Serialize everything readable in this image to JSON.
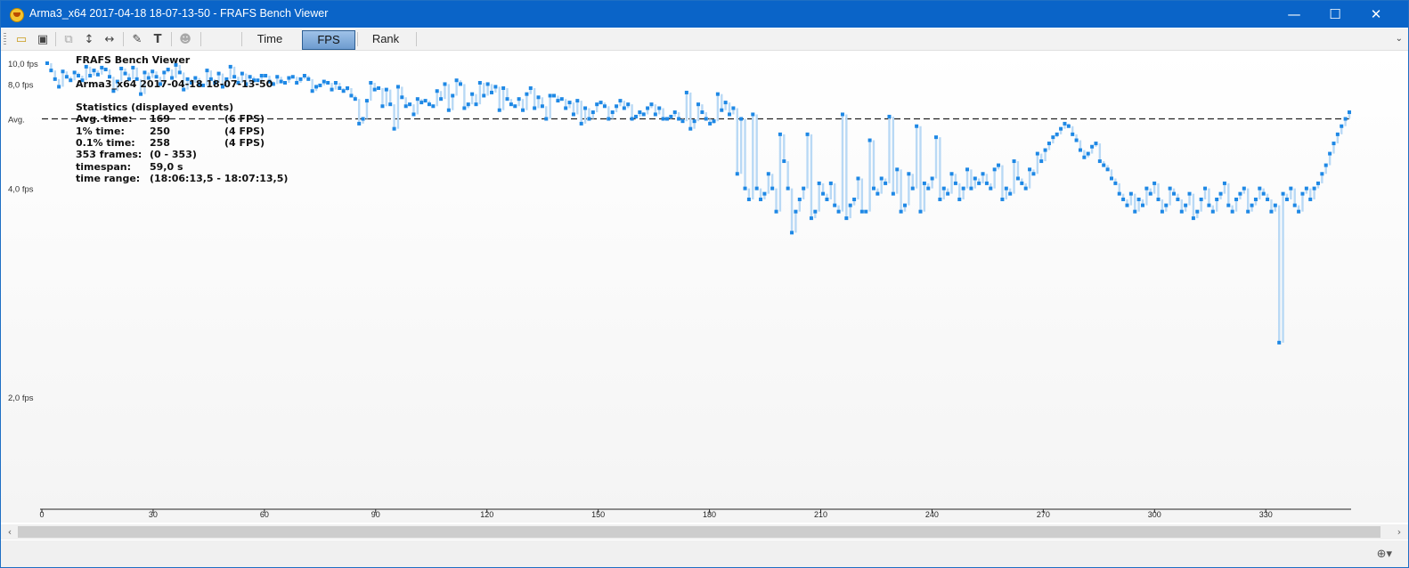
{
  "window": {
    "title": "Arma3_x64 2017-04-18 18-07-13-50 - FRAFS Bench Viewer",
    "controls": {
      "minimize": "—",
      "maximize": "☐",
      "close": "✕"
    }
  },
  "toolbar": {
    "icons": [
      "open-folder-icon",
      "save-icon",
      "copy-icon",
      "fit-height-icon",
      "fit-width-icon",
      "settings-wrench-icon",
      "text-icon",
      "user-icon"
    ],
    "tabs": [
      {
        "label": "Time",
        "active": false
      },
      {
        "label": "FPS",
        "active": true
      },
      {
        "label": "Rank",
        "active": false
      }
    ],
    "overflow": "⌄"
  },
  "stats": {
    "app_name": "FRAFS Bench Viewer",
    "session": "Arma3_x64 2017-04-18 18-07-13-50",
    "heading": "Statistics (displayed events)",
    "rows": [
      {
        "label": "Avg. time:",
        "value": "169",
        "extra": "(6 FPS)"
      },
      {
        "label": "1% time:",
        "value": "250",
        "extra": "(4 FPS)"
      },
      {
        "label": "0.1% time:",
        "value": "258",
        "extra": "(4 FPS)"
      },
      {
        "label": "353 frames:",
        "value": "(0 - 353)",
        "extra": ""
      },
      {
        "label": "timespan:",
        "value": "59,0 s",
        "extra": ""
      },
      {
        "label": "time range:",
        "value": "(18:06:13,5 - 18:07:13,5)",
        "extra": ""
      }
    ]
  },
  "chart_data": {
    "type": "scatter",
    "xlabel": "",
    "ylabel": "",
    "x_ticks": [
      0,
      30,
      60,
      90,
      120,
      150,
      180,
      210,
      240,
      270,
      300,
      330
    ],
    "xlim": [
      0,
      353
    ],
    "y_ticks": [
      {
        "value": 10.0,
        "label": "10,0 fps"
      },
      {
        "value": 8.0,
        "label": "8,0 fps"
      },
      {
        "value": 6.0,
        "label": "Avg."
      },
      {
        "value": 4.0,
        "label": "4,0 fps"
      },
      {
        "value": 2.0,
        "label": "2,0 fps"
      }
    ],
    "ylim": [
      0,
      10.0
    ],
    "average": 6.0,
    "average_label": "Avg.",
    "grid": false,
    "point_color": "#1e88e5",
    "segment_color": "#b9d9f5",
    "series": [
      {
        "values": [
          10.0,
          9.2,
          8.4,
          7.8,
          9.1,
          8.6,
          8.3,
          9.0,
          8.7,
          8.3,
          9.6,
          8.7,
          9.2,
          8.8,
          9.5,
          9.3,
          8.6,
          7.5,
          8.2,
          9.4,
          8.9,
          8.4,
          9.5,
          8.4,
          7.3,
          9.0,
          8.5,
          9.1,
          8.6,
          8.0,
          9.0,
          9.3,
          8.5,
          9.8,
          9.0,
          7.6,
          8.4,
          8.1,
          8.5,
          8.0,
          7.9,
          9.2,
          8.4,
          8.1,
          8.9,
          7.8,
          8.4,
          9.6,
          8.6,
          8.1,
          8.9,
          8.0,
          8.6,
          8.3,
          8.3,
          8.7,
          8.7,
          8.2,
          8.0,
          8.6,
          8.2,
          8.1,
          8.5,
          8.6,
          8.1,
          8.4,
          8.7,
          8.4,
          7.5,
          7.8,
          7.9,
          8.2,
          8.1,
          7.6,
          8.1,
          7.7,
          7.5,
          7.7,
          7.2,
          7.0,
          5.8,
          6.0,
          6.9,
          8.1,
          7.6,
          7.7,
          6.6,
          7.6,
          6.7,
          5.6,
          7.8,
          7.1,
          6.6,
          6.7,
          6.2,
          7.0,
          6.8,
          6.9,
          6.7,
          6.6,
          7.5,
          7.0,
          8.0,
          6.4,
          7.2,
          8.3,
          8.0,
          6.5,
          6.7,
          7.3,
          6.7,
          8.1,
          7.2,
          8.0,
          7.4,
          7.8,
          6.4,
          7.7,
          7.0,
          6.7,
          6.6,
          7.0,
          6.4,
          7.3,
          7.7,
          6.5,
          7.1,
          6.6,
          6.0,
          7.2,
          7.2,
          6.9,
          7.0,
          6.5,
          6.8,
          6.2,
          6.9,
          5.8,
          6.5,
          6.0,
          6.3,
          6.7,
          6.8,
          6.6,
          6.0,
          6.3,
          6.6,
          6.9,
          6.5,
          6.7,
          6.0,
          6.1,
          6.3,
          6.2,
          6.5,
          6.7,
          6.2,
          6.5,
          6.0,
          6.0,
          6.1,
          6.3,
          6.0,
          5.9,
          7.4,
          5.6,
          5.9,
          6.7,
          6.3,
          6.0,
          5.8,
          5.9,
          7.3,
          6.4,
          6.8,
          6.2,
          6.5,
          4.3,
          6.0,
          4.0,
          3.8,
          6.2,
          4.0,
          3.8,
          3.9,
          4.3,
          4.0,
          3.6,
          5.4,
          4.6,
          4.0,
          3.3,
          3.6,
          3.8,
          4.0,
          5.4,
          3.5,
          3.6,
          4.1,
          3.9,
          3.8,
          4.1,
          3.7,
          3.6,
          6.2,
          3.5,
          3.7,
          3.8,
          4.2,
          3.6,
          3.6,
          5.2,
          4.0,
          3.9,
          4.2,
          4.1,
          6.1,
          3.9,
          4.4,
          3.6,
          3.7,
          4.3,
          4.0,
          5.7,
          3.6,
          4.1,
          4.0,
          4.2,
          5.3,
          3.8,
          4.0,
          3.9,
          4.3,
          4.1,
          3.8,
          4.0,
          4.4,
          4.0,
          4.2,
          4.1,
          4.3,
          4.1,
          4.0,
          4.4,
          4.5,
          3.8,
          4.0,
          3.9,
          4.6,
          4.2,
          4.1,
          4.0,
          4.4,
          4.3,
          4.8,
          4.6,
          4.9,
          5.1,
          5.3,
          5.4,
          5.6,
          5.8,
          5.7,
          5.4,
          5.2,
          4.9,
          4.7,
          4.8,
          5.0,
          5.1,
          4.6,
          4.5,
          4.4,
          4.2,
          4.1,
          3.9,
          3.8,
          3.7,
          3.9,
          3.6,
          3.8,
          3.7,
          4.0,
          3.9,
          4.1,
          3.8,
          3.6,
          3.7,
          4.0,
          3.9,
          3.8,
          3.6,
          3.7,
          3.9,
          3.5,
          3.6,
          3.8,
          4.0,
          3.7,
          3.6,
          3.8,
          3.9,
          4.1,
          3.7,
          3.6,
          3.8,
          3.9,
          4.0,
          3.6,
          3.7,
          3.8,
          4.0,
          3.9,
          3.8,
          3.6,
          3.7,
          2.3,
          3.9,
          3.8,
          4.0,
          3.7,
          3.6,
          3.9,
          4.0,
          3.8,
          4.0,
          4.1,
          4.3,
          4.5,
          4.8,
          5.1,
          5.4,
          5.7,
          6.0,
          6.3
        ]
      }
    ]
  }
}
